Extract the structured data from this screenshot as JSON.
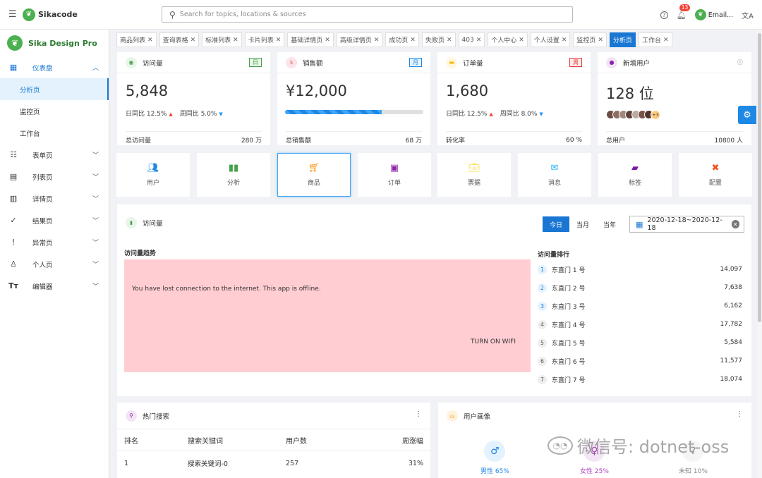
{
  "topbar": {
    "logo_text": "Sikacode",
    "search_placeholder": "Search for topics, locations & sources",
    "notification_count": "13",
    "user_label": "Email..."
  },
  "sidebar": {
    "brand": "Sika Design Pro",
    "dashboard": "仪表盘",
    "sub_items": [
      "分析页",
      "监控页",
      "工作台"
    ],
    "items": [
      "表单页",
      "列表页",
      "详情页",
      "结果页",
      "异常页",
      "个人页",
      "编辑器"
    ]
  },
  "tabs": [
    "商品列表",
    "查询表格",
    "标准列表",
    "卡片列表",
    "基础详情页",
    "高级详情页",
    "成功页",
    "失败页",
    "403",
    "个人中心",
    "个人设置",
    "监控页",
    "分析页",
    "工作台"
  ],
  "stats": [
    {
      "title": "访问量",
      "pill": "日",
      "value": "5,848",
      "d1": "日同比 12.5%",
      "d2": "周同比 5.0%",
      "foot_label": "总访问量",
      "foot_value": "280 万"
    },
    {
      "title": "销售额",
      "pill": "月",
      "value": "¥12,000",
      "progress": 0.7,
      "foot_label": "总销售额",
      "foot_value": "68 万"
    },
    {
      "title": "订单量",
      "pill": "周",
      "value": "1,680",
      "d1": "日同比 12.5%",
      "d2": "周同比 8.0%",
      "foot_label": "转化率",
      "foot_value": "60 %"
    },
    {
      "title": "新增用户",
      "value": "128 位",
      "more": "+3",
      "foot_label": "总用户",
      "foot_value": "10800 人"
    }
  ],
  "quick_actions": [
    "用户",
    "分析",
    "商品",
    "订单",
    "票据",
    "消息",
    "标签",
    "配置"
  ],
  "visits": {
    "title": "访问量",
    "periods": [
      "今日",
      "当月",
      "当年"
    ],
    "date_range": "2020-12-18~2020-12-18",
    "trend_title": "访问量趋势",
    "offline_msg": "You have lost connection to the internet. This app is offline.",
    "offline_btn": "TURN ON WIFI",
    "rank_title": "访问量排行",
    "ranks": [
      {
        "n": "1",
        "name": "东直门 1 号",
        "v": "14,097"
      },
      {
        "n": "2",
        "name": "东直门 2 号",
        "v": "7,638"
      },
      {
        "n": "3",
        "name": "东直门 3 号",
        "v": "6,162"
      },
      {
        "n": "4",
        "name": "东直门 4 号",
        "v": "17,782"
      },
      {
        "n": "5",
        "name": "东直门 5 号",
        "v": "5,584"
      },
      {
        "n": "6",
        "name": "东直门 6 号",
        "v": "11,577"
      },
      {
        "n": "7",
        "name": "东直门 7 号",
        "v": "18,074"
      }
    ]
  },
  "hot_search": {
    "title": "热门搜索",
    "headers": [
      "排名",
      "搜索关键词",
      "用户数",
      "周涨幅"
    ],
    "row": [
      "1",
      "搜索关键词-0",
      "257",
      "31%"
    ]
  },
  "portrait": {
    "title": "用户画像",
    "male": "男性 65%",
    "female": "女性 25%",
    "unknown": "未知 10%"
  },
  "watermark": "微信号: dotnet-oss"
}
